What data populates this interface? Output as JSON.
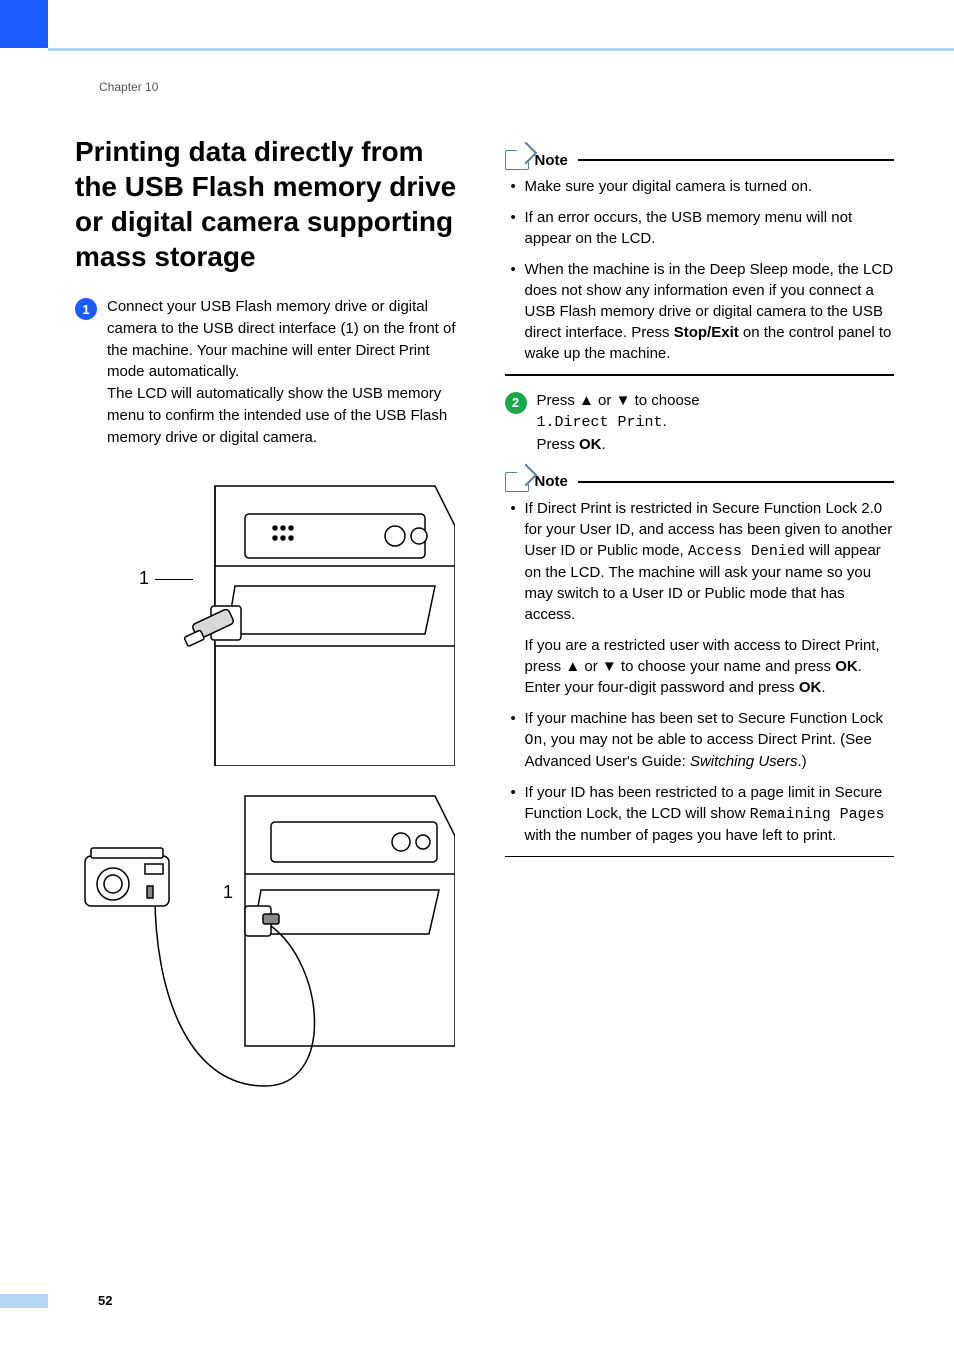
{
  "chapter": "Chapter 10",
  "title": "Printing data directly from the USB Flash memory drive or digital camera supporting mass storage",
  "step1": {
    "num": "1",
    "text_a": "Connect your USB Flash memory drive or digital camera to the USB direct interface (1) on the front of the machine. Your machine will enter Direct Print mode automatically.",
    "text_b": "The LCD will automatically show the USB memory menu to confirm the intended use of the USB Flash memory drive or digital camera."
  },
  "figure": {
    "label1": "1",
    "label2": "1"
  },
  "note1": {
    "label": "Note",
    "items": [
      "Make sure your digital camera is turned on.",
      "If an error occurs, the USB memory menu will not appear on the LCD."
    ],
    "item3_pre": "When the machine is in the Deep Sleep mode, the LCD does not show any information even if you connect a USB Flash memory drive or digital camera to the USB direct interface. Press ",
    "item3_bold": "Stop/Exit",
    "item3_post": " on the control panel to wake up the machine."
  },
  "step2": {
    "num": "2",
    "line1_pre": "Press ",
    "up": "▲",
    "or": " or ",
    "down": "▼",
    "line1_post": " to choose ",
    "mono": "1.Direct Print",
    "line1_end": ".",
    "line2_pre": "Press ",
    "line2_bold": "OK",
    "line2_end": "."
  },
  "note2": {
    "label": "Note",
    "item1": {
      "pre": "If Direct Print is restricted in Secure Function Lock 2.0 for your User ID, and access has been given to another User ID or Public mode, ",
      "mono": "Access Denied",
      "post": " will appear on the LCD. The machine will ask your name so you may switch to a User ID or Public mode that has access.",
      "para2_pre": "If you are a restricted user with access to Direct Print, press ",
      "up": "▲",
      "or": " or ",
      "down": "▼",
      "para2_mid1": " to choose your name and press ",
      "ok1": "OK",
      "para2_mid2": ". Enter your four-digit password and press ",
      "ok2": "OK",
      "para2_end": "."
    },
    "item2": {
      "pre": "If your machine has been set to Secure Function Lock ",
      "mono": "On",
      "mid": ", you may not be able to access Direct Print. (See Advanced User's Guide: ",
      "ital": "Switching Users",
      "post": ".)"
    },
    "item3": {
      "pre": "If your ID has been restricted to a page limit in Secure Function Lock, the LCD will show ",
      "mono": "Remaining Pages",
      "post": " with the number of pages you have left to print."
    }
  },
  "page_number": "52"
}
